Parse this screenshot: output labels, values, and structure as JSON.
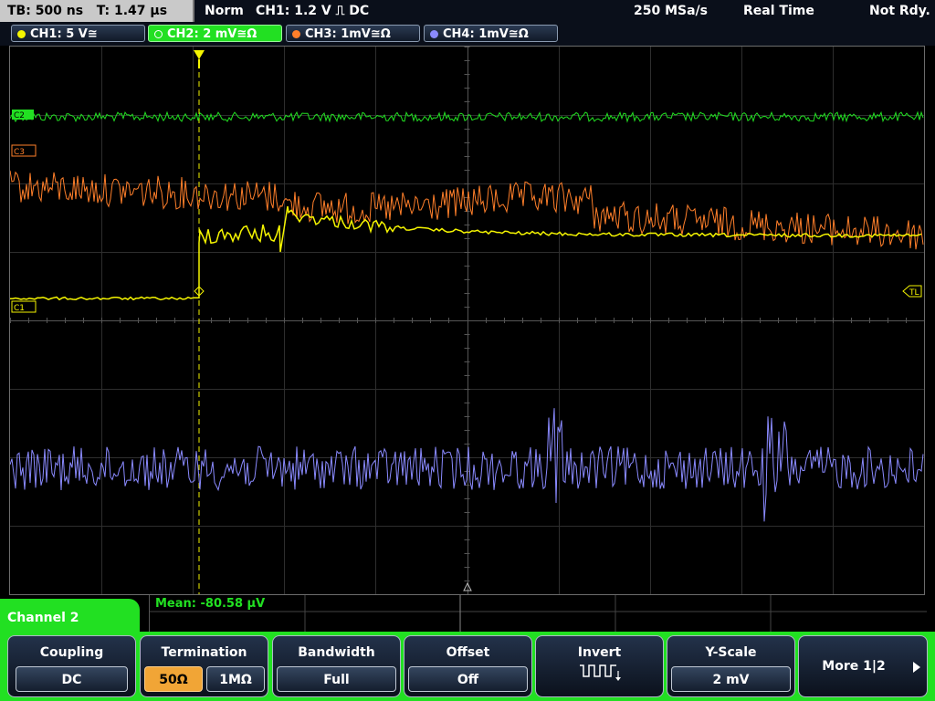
{
  "status": {
    "timebase": "TB: 500 ns",
    "trigger_time": "T: 1.47 µs",
    "mode": "Norm",
    "trigger": "CH1: 1.2 V ⎍ DC",
    "sample_rate": "250 MSa/s",
    "acquisition": "Real Time",
    "ready": "Not Rdy."
  },
  "channels": [
    {
      "label": "CH1: 5 V≅",
      "color": "#f5f500"
    },
    {
      "label": "CH2: 2 mV≅Ω",
      "color": "#22e022"
    },
    {
      "label": "CH3: 1mV≅Ω",
      "color": "#ff7f2a"
    },
    {
      "label": "CH4: 1mV≅Ω",
      "color": "#8a8aff"
    }
  ],
  "markers": {
    "c1": "C1",
    "c2": "C2",
    "c3": "C3",
    "tl": "TL"
  },
  "measurement": "Mean: -80.58 µV",
  "menu": {
    "channel_title": "Channel 2",
    "coupling": {
      "title": "Coupling",
      "value": "DC"
    },
    "termination": {
      "title": "Termination",
      "opt1": "50Ω",
      "opt2": "1MΩ"
    },
    "bandwidth": {
      "title": "Bandwidth",
      "value": "Full"
    },
    "offset": {
      "title": "Offset",
      "value": "Off"
    },
    "invert": {
      "title": "Invert",
      "icon": "inverted-square-wave-icon"
    },
    "yscale": {
      "title": "Y-Scale",
      "value": "2 mV"
    },
    "more": {
      "label": "More 1|2",
      "icon": "chevron-right-icon"
    }
  },
  "colors": {
    "accent": "#22e022",
    "selected": "#f1a536",
    "grid": "#3a3a3a"
  }
}
